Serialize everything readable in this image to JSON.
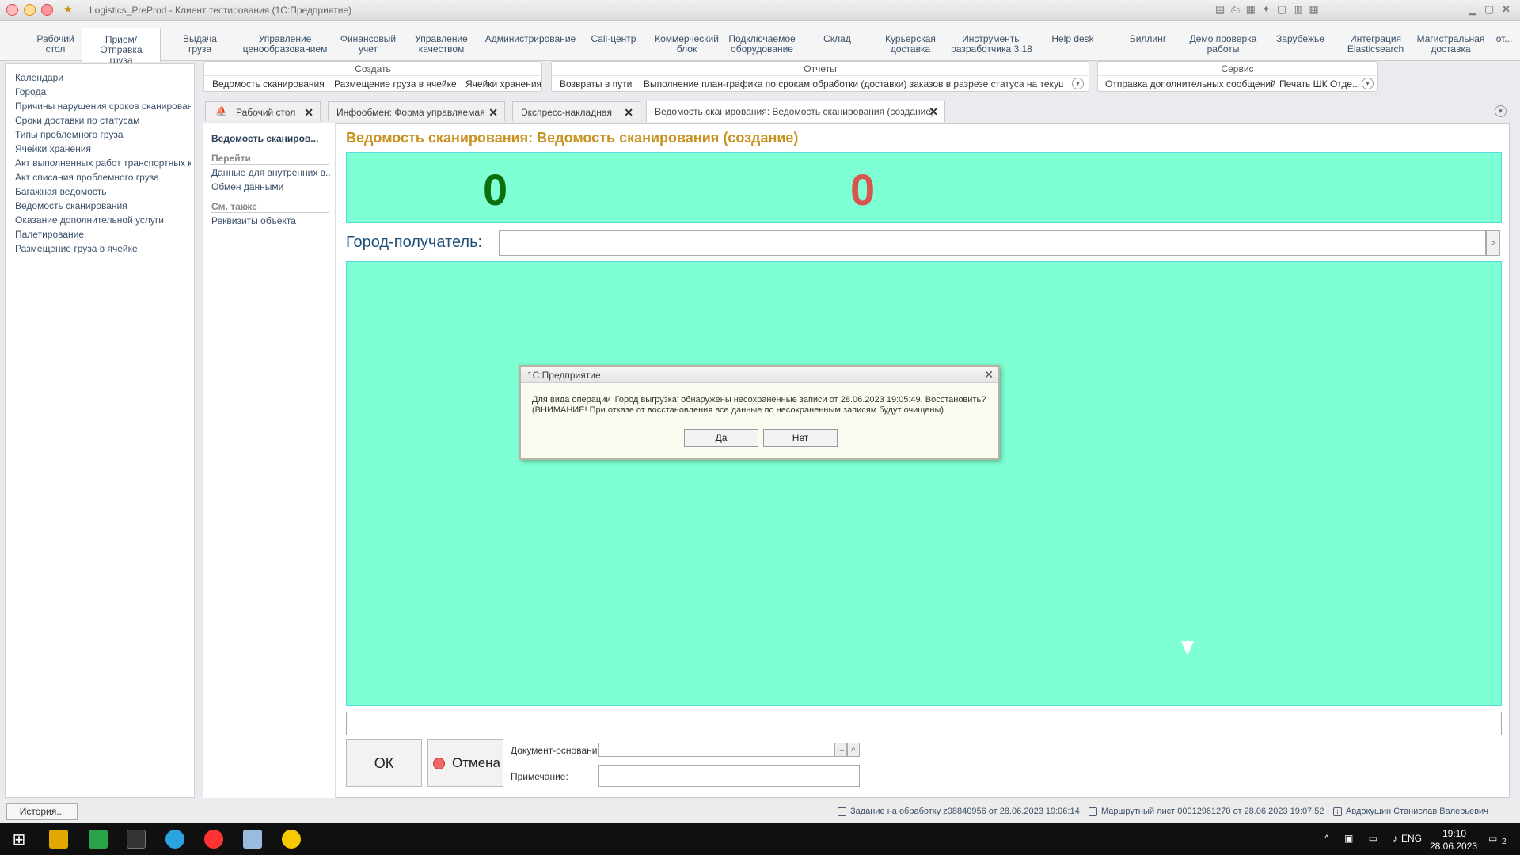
{
  "window": {
    "title": "Logistics_PreProd - Клиент тестирования (1С:Предприятие)"
  },
  "sections": [
    {
      "label": "Рабочий\nстол"
    },
    {
      "label": "Прием/Отправка\nгруза"
    },
    {
      "label": "Выдача\nгруза"
    },
    {
      "label": "Управление\nценообразованием"
    },
    {
      "label": "Финансовый\nучет"
    },
    {
      "label": "Управление\nкачеством"
    },
    {
      "label": "Администрирование"
    },
    {
      "label": "Call-центр"
    },
    {
      "label": "Коммерческий\nблок"
    },
    {
      "label": "Подключаемое\nоборудование"
    },
    {
      "label": "Склад"
    },
    {
      "label": "Курьерская\nдоставка"
    },
    {
      "label": "Инструменты\nразработчика 3.18"
    },
    {
      "label": "Help desk"
    },
    {
      "label": "Биллинг"
    },
    {
      "label": "Демо проверка\nработы"
    },
    {
      "label": "Зарубежье"
    },
    {
      "label": "Интеграция\nElasticsearch"
    },
    {
      "label": "Магистральная\nдоставка"
    },
    {
      "label": "от..."
    }
  ],
  "leftnav": [
    "Календари",
    "Города",
    "Причины нарушения сроков сканирован...",
    "Сроки доставки по статусам",
    "Типы проблемного груза",
    "Ячейки хранения",
    "Акт выполненных работ транспортных к...",
    "Акт списания проблемного груза",
    "Багажная ведомость",
    "Ведомость сканирования",
    "Оказание дополнительной услуги",
    "Палетирование",
    "Размещение груза в ячейке"
  ],
  "commands": {
    "create": {
      "caption": "Создать",
      "items": [
        "Ведомость сканирования",
        "Размещение груза в ячейке",
        "Ячейки хранения"
      ]
    },
    "reports": {
      "caption": "Отчеты",
      "items": [
        "Возвраты в пути",
        "Выполнение план-графика по срокам обработки (доставки) заказов в разрезе статуса на текущий м..."
      ]
    },
    "service": {
      "caption": "Сервис",
      "items": [
        "Отправка дополнительных сообщений",
        "Печать ШК Отде..."
      ]
    }
  },
  "tabs": [
    {
      "label": "Рабочий стол"
    },
    {
      "label": "Инфообмен: Форма управляемая"
    },
    {
      "label": "Экспресс-накладная"
    },
    {
      "label": "Ведомость сканирования: Ведомость сканирования (создание)"
    }
  ],
  "formnav": {
    "current": "Ведомость сканиров...",
    "goto_group": "Перейти",
    "goto_items": [
      "Данные для внутренних в...",
      "Обмен данными"
    ],
    "see_also_group": "См. также",
    "see_also_items": [
      "Реквизиты объекта"
    ]
  },
  "form": {
    "title": "Ведомость сканирования: Ведомость сканирования (создание)",
    "counter_left": "0",
    "counter_right": "0",
    "city_label": "Город-получатель:",
    "city_value": "",
    "ok_label": "ОК",
    "cancel_label": "Отмена",
    "doc_basis_label": "Документ-основание:",
    "doc_basis_value": "",
    "note_label": "Примечание:",
    "note_value": ""
  },
  "dialog": {
    "title": "1С:Предприятие",
    "message": "Для вида операции 'Город выгрузка' обнаружены несохраненные записи от 28.06.2023 19:05:49. Восстановить? (ВНИМАНИЕ! При отказе от восстановления все данные по несохраненным записям будут очищены)",
    "yes": "Да",
    "no": "Нет"
  },
  "statusbar": {
    "history": "История...",
    "items": [
      "Задание на обработку z08840956 от 28.06.2023 19:06:14",
      "Маршрутный лист 00012961270 от 28.06.2023 19:07:52",
      "Авдокушин Станислав Валерьевич"
    ]
  },
  "taskbar": {
    "lang": "ENG",
    "time": "19:10",
    "date": "28.06.2023",
    "notif": "2"
  },
  "colors": {
    "form_bg": "#7fffd4",
    "counter_left": "#0c6e0c",
    "counter_right": "#d9534f",
    "title": "#c8921e"
  }
}
